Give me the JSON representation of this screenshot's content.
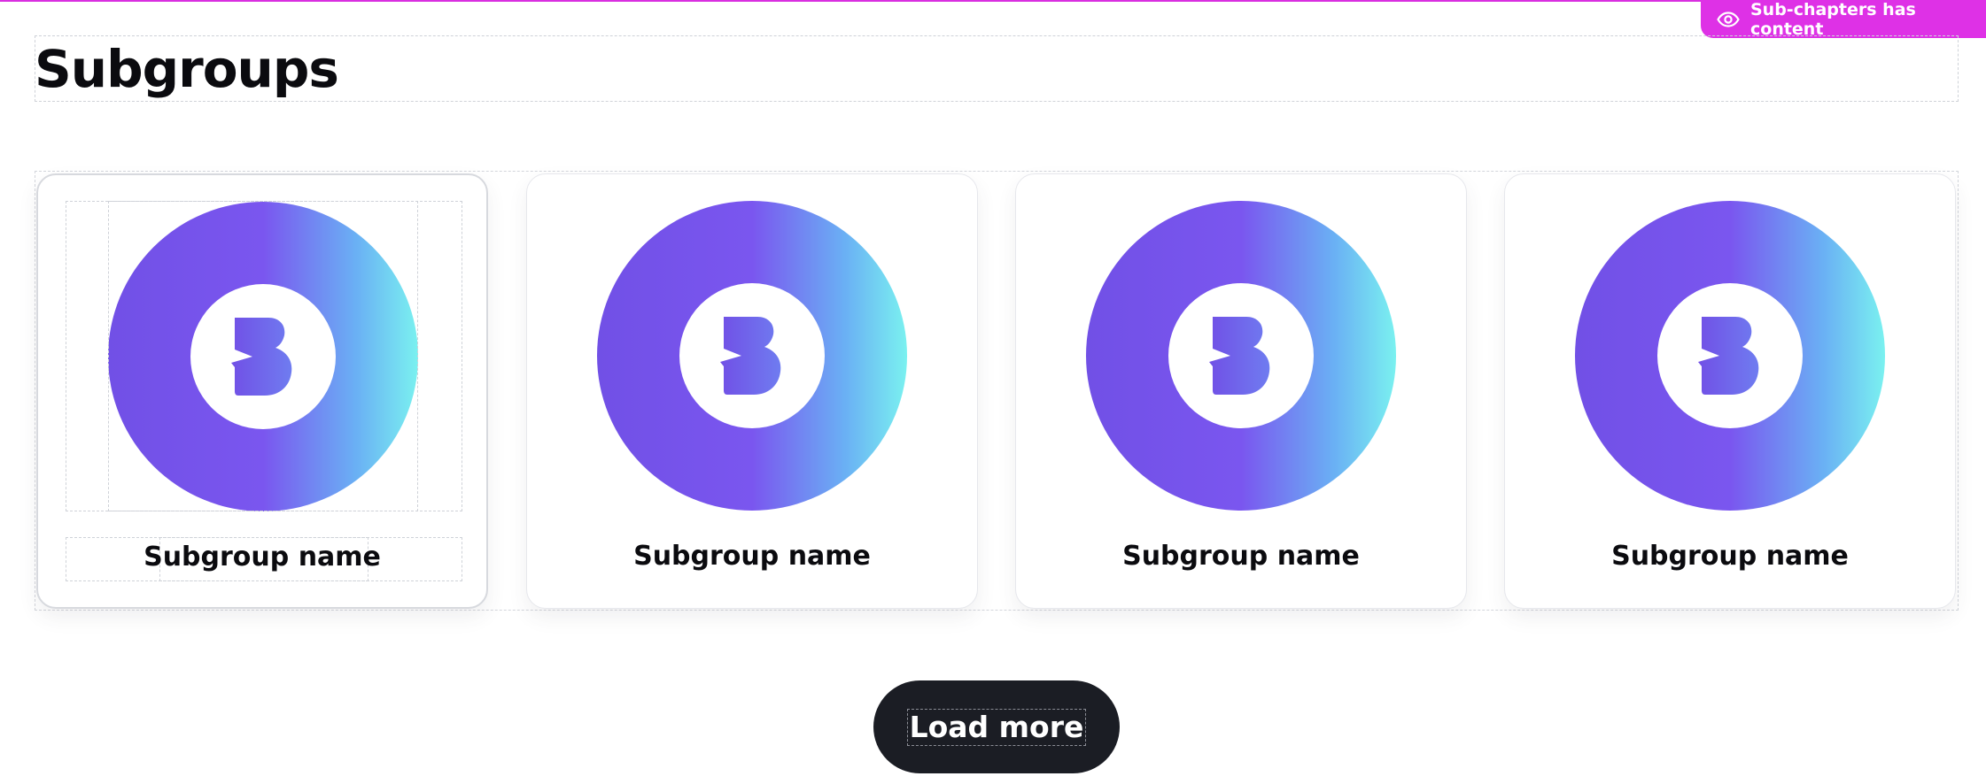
{
  "badge": {
    "label": "Sub-chapters has content",
    "icon": "eye-icon",
    "color": "#de31e6"
  },
  "section": {
    "title": "Subgroups"
  },
  "subgroups": [
    {
      "name": "Subgroup name",
      "icon": "b-logo-icon"
    },
    {
      "name": "Subgroup name",
      "icon": "b-logo-icon"
    },
    {
      "name": "Subgroup name",
      "icon": "b-logo-icon"
    },
    {
      "name": "Subgroup name",
      "icon": "b-logo-icon"
    }
  ],
  "load_more": {
    "label": "Load more"
  },
  "colors": {
    "accent_magenta": "#de31e6",
    "button_dark": "#1b1d24",
    "gradient_purple": "#7a56ef",
    "gradient_cyan": "#7af1f0"
  }
}
